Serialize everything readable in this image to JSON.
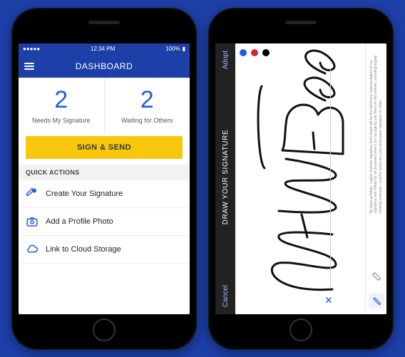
{
  "statusbar": {
    "carrier": "●●●●●",
    "time": "12:34 PM",
    "battery": "100%"
  },
  "dashboard": {
    "title": "DASHBOARD",
    "counts": [
      {
        "value": "2",
        "label": "Needs My Signature"
      },
      {
        "value": "2",
        "label": "Waiting for Others"
      }
    ],
    "sign_send_label": "SIGN & SEND",
    "quick_actions_header": "QUICK ACTIONS",
    "quick_actions": [
      {
        "label": "Create Your Signature"
      },
      {
        "label": "Add a Profile Photo"
      },
      {
        "label": "Link to Cloud Storage"
      }
    ]
  },
  "signature": {
    "cancel_label": "Cancel",
    "title": "DRAW YOUR SIGNATURE",
    "adopt_label": "Adopt",
    "signer_name": "Tom Wood",
    "colors": [
      "#2a5bd7",
      "#d23",
      "#000"
    ],
    "legal_text": "By tapping Adopt, I agree that the signature and initials will be the electronic representation of my signature and initials for all purposes when I (or my agent) use them on documents, including legally binding contracts - just the same as a pen-and-paper signature or initial."
  }
}
